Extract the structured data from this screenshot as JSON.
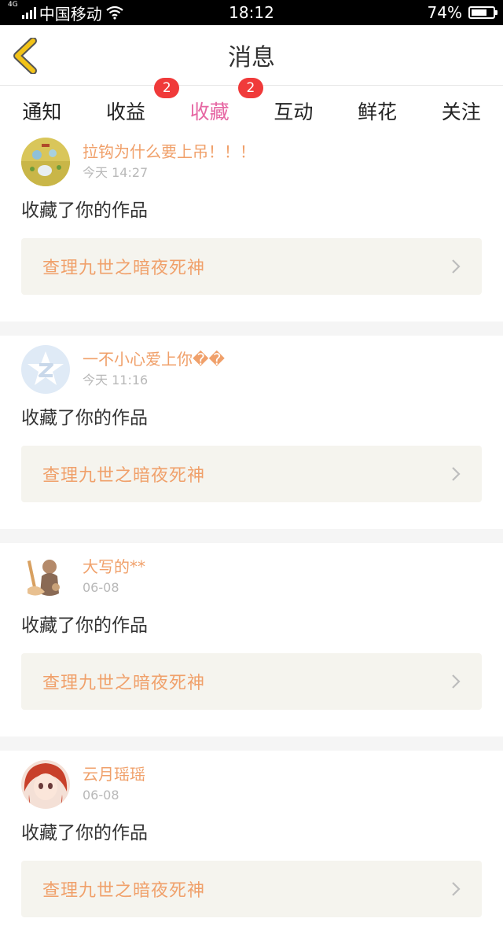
{
  "status_bar": {
    "network": "4G",
    "carrier": "中国移动",
    "time": "18:12",
    "battery_text": "74%",
    "battery_level": 0.74
  },
  "nav": {
    "title": "消息"
  },
  "tabs": [
    {
      "label": "通知",
      "badge": null,
      "active": false
    },
    {
      "label": "收益",
      "badge": "2",
      "active": false
    },
    {
      "label": "收藏",
      "badge": "2",
      "active": true
    },
    {
      "label": "互动",
      "badge": null,
      "active": false
    },
    {
      "label": "鲜花",
      "badge": null,
      "active": false
    },
    {
      "label": "关注",
      "badge": null,
      "active": false
    }
  ],
  "feed": [
    {
      "user": "拉钩为什么要上吊！！！",
      "time": "今天 14:27",
      "action": "收藏了你的作品",
      "work": "查理九世之暗夜死神",
      "avatar": "game-avatar"
    },
    {
      "user": "一不小心爱上你��",
      "time": "今天 11:16",
      "action": "收藏了你的作品",
      "work": "查理九世之暗夜死神",
      "avatar": "qzone-avatar"
    },
    {
      "user": "大写的**",
      "time": "06-08",
      "action": "收藏了你的作品",
      "work": "查理九世之暗夜死神",
      "avatar": "anime-knight-avatar"
    },
    {
      "user": "云月瑶瑶",
      "time": "06-08",
      "action": "收藏了你的作品",
      "work": "查理九世之暗夜死神",
      "avatar": "anime-girl-avatar"
    }
  ],
  "colors": {
    "accent": "#e667a3",
    "badge": "#f03a3a",
    "name": "#f0a06a",
    "back_icon": "#f2c318"
  }
}
